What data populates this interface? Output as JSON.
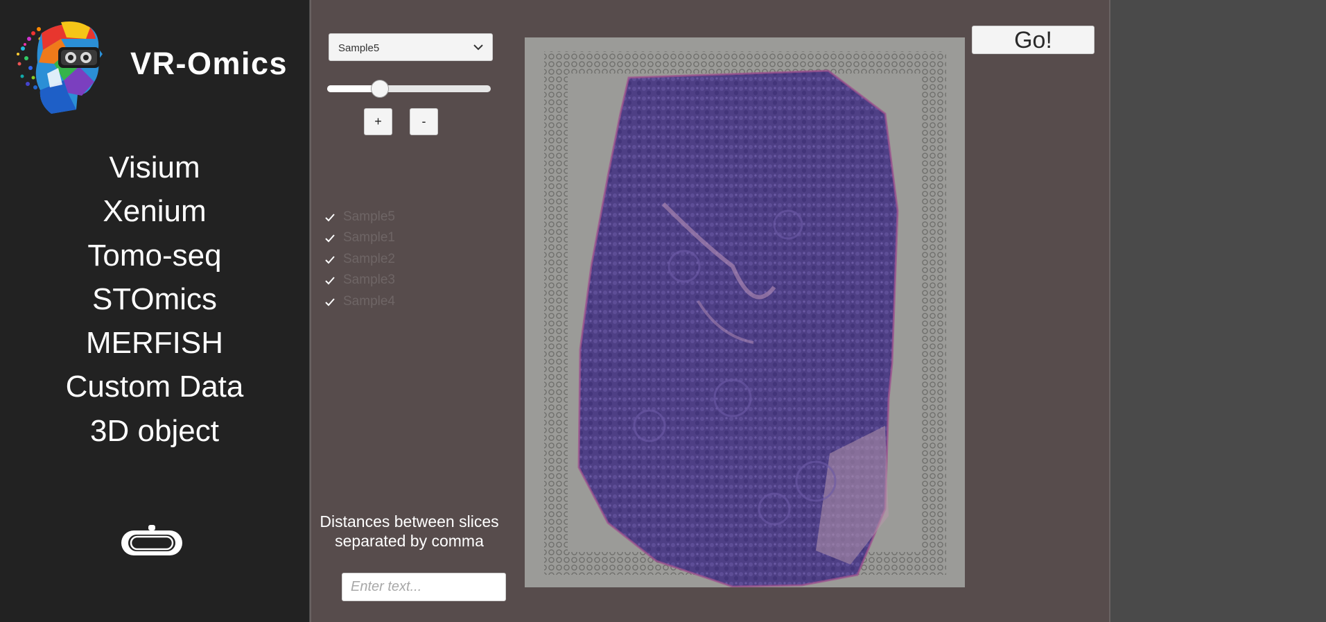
{
  "app": {
    "title": "VR-Omics"
  },
  "sidebar": {
    "items": [
      {
        "label": "Visium"
      },
      {
        "label": "Xenium"
      },
      {
        "label": "Tomo-seq"
      },
      {
        "label": "STOmics"
      },
      {
        "label": "MERFISH"
      },
      {
        "label": "Custom Data"
      },
      {
        "label": "3D object"
      }
    ],
    "vr_icon": "vr-headset-icon"
  },
  "controls": {
    "dropdown": {
      "selected": "Sample5",
      "icon": "chevron-down-icon"
    },
    "slider": {
      "value_fraction": 0.32
    },
    "plus_label": "+",
    "minus_label": "-"
  },
  "samples": {
    "items": [
      {
        "label": "Sample5",
        "checked": true
      },
      {
        "label": "Sample1",
        "checked": true
      },
      {
        "label": "Sample2",
        "checked": true
      },
      {
        "label": "Sample3",
        "checked": true
      },
      {
        "label": "Sample4",
        "checked": true
      }
    ]
  },
  "distance": {
    "label_line1": "Distances between slices",
    "label_line2": "separated by comma",
    "placeholder": "Enter text..."
  },
  "go_button": {
    "label": "Go!"
  },
  "colors": {
    "sidebar_bg": "#222222",
    "panel_bg": "#574c4c",
    "tissue_purple": "#5a4a8c"
  }
}
